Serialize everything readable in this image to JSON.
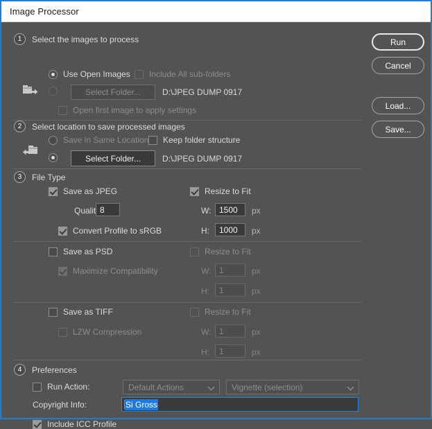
{
  "window": {
    "title": "Image Processor",
    "accent_border": "#1b7fd4",
    "background": "#535353"
  },
  "buttons": {
    "run": "Run",
    "cancel": "Cancel",
    "load": "Load...",
    "save": "Save..."
  },
  "step1": {
    "number": "1",
    "title": "Select the images to process",
    "use_open_images": "Use Open Images",
    "use_open_images_selected": true,
    "include_subfolders": "Include All sub-folders",
    "include_subfolders_checked": false,
    "select_folder_button": "Select Folder...",
    "folder_radio_selected": false,
    "folder_path": "D:\\JPEG DUMP 0917",
    "open_first_image": "Open first image to apply settings",
    "open_first_image_checked": false,
    "source_icon": "folder-export-icon"
  },
  "step2": {
    "number": "2",
    "title": "Select location to save processed images",
    "save_same_location": "Save in Same Location",
    "save_same_location_selected": false,
    "keep_folder_structure": "Keep folder structure",
    "keep_folder_structure_checked": false,
    "select_folder_button": "Select Folder...",
    "folder_radio_selected": true,
    "folder_path": "D:\\JPEG DUMP 0917",
    "dest_icon": "folder-import-icon"
  },
  "step3": {
    "number": "3",
    "title": "File Type",
    "jpeg": {
      "save_as": "Save as JPEG",
      "save_as_checked": true,
      "quality_label": "Quality:",
      "quality_value": "8",
      "convert_srgb": "Convert Profile to sRGB",
      "convert_srgb_checked": true,
      "resize_to_fit": "Resize to Fit",
      "resize_to_fit_checked": true,
      "w_label": "W:",
      "w_value": "1500",
      "h_label": "H:",
      "h_value": "1000",
      "unit": "px"
    },
    "psd": {
      "save_as": "Save as PSD",
      "save_as_checked": false,
      "maximize_compatibility": "Maximize Compatibility",
      "maximize_compatibility_checked": true,
      "resize_to_fit": "Resize to Fit",
      "resize_to_fit_checked": false,
      "w_label": "W:",
      "w_value": "1",
      "h_label": "H:",
      "h_value": "1",
      "unit": "px"
    },
    "tiff": {
      "save_as": "Save as TIFF",
      "save_as_checked": false,
      "lzw_compression": "LZW Compression",
      "lzw_compression_checked": false,
      "resize_to_fit": "Resize to Fit",
      "resize_to_fit_checked": false,
      "w_label": "W:",
      "w_value": "1",
      "h_label": "H:",
      "h_value": "1",
      "unit": "px"
    }
  },
  "step4": {
    "number": "4",
    "title": "Preferences",
    "run_action_label": "Run Action:",
    "run_action_checked": false,
    "action_set": "Default Actions",
    "action_name": "Vignette (selection)",
    "copyright_label": "Copyright Info:",
    "copyright_value": "Si Gross",
    "copyright_selected": true,
    "include_icc": "Include ICC Profile",
    "include_icc_checked": true
  }
}
